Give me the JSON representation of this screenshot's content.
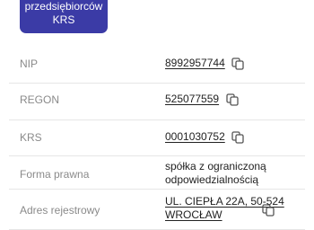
{
  "header": {
    "button_line1": "przedsiębiorców",
    "button_line2": "KRS"
  },
  "details": [
    {
      "label": "NIP",
      "value": "8992957744",
      "copyable": true
    },
    {
      "label": "REGON",
      "value": "525077559",
      "copyable": true
    },
    {
      "label": "KRS",
      "value": "0001030752",
      "copyable": true
    },
    {
      "label": "Forma prawna",
      "value_line1": "spółka z ograniczoną",
      "value_line2": "odpowiedzialnością",
      "copyable": false
    },
    {
      "label": "Adres rejestrowy",
      "value_line1": "UL. CIEPŁA 22A, 50-524",
      "value_line2": "WROCŁAW",
      "copyable": true
    }
  ],
  "icons": {
    "copy": "copy-icon"
  },
  "colors": {
    "accent": "#3b3ba6"
  }
}
